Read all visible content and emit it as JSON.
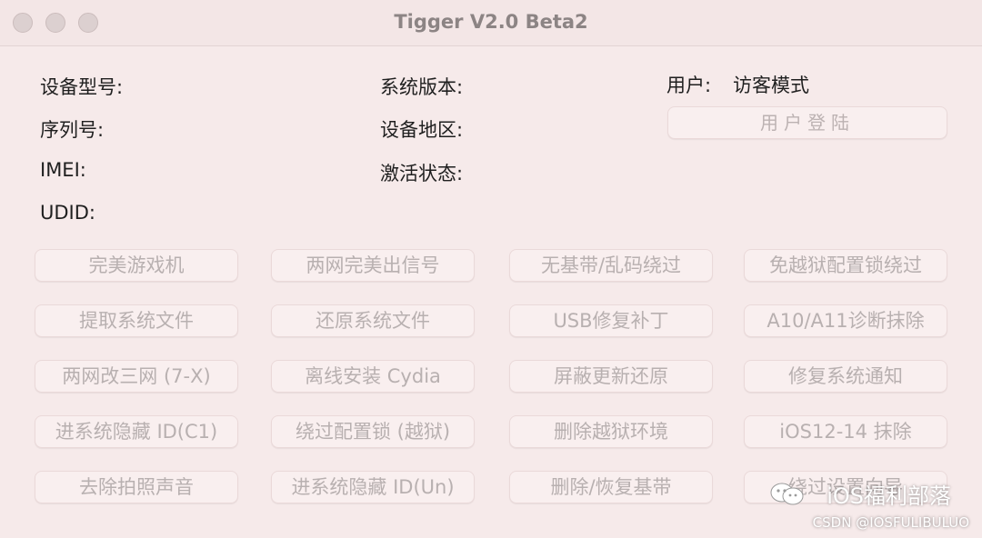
{
  "window": {
    "title": "Tigger V2.0 Beta2"
  },
  "info": {
    "device_model": "设备型号:",
    "serial": "序列号:",
    "imei": "IMEI:",
    "udid": "UDID:",
    "sys_version": "系统版本:",
    "region": "设备地区:",
    "activation": "激活状态:",
    "user_label": "用户:",
    "user_value": "访客模式"
  },
  "login_label": "用户登陆",
  "buttons": [
    "完美游戏机",
    "两网完美出信号",
    "无基带/乱码绕过",
    "免越狱配置锁绕过",
    "提取系统文件",
    "还原系统文件",
    "USB修复补丁",
    "A10/A11诊断抹除",
    "两网改三网 (7-X)",
    "离线安装 Cydia",
    "屏蔽更新还原",
    "修复系统通知",
    "进系统隐藏 ID(C1)",
    "绕过配置锁 (越狱)",
    "删除越狱环境",
    "iOS12-14 抹除",
    "去除拍照声音",
    "进系统隐藏 ID(Un)",
    "删除/恢复基带",
    "绕过设置向导"
  ],
  "watermark": {
    "text": "iOS福利部落",
    "source": "CSDN @IOSFULIBULUO"
  }
}
